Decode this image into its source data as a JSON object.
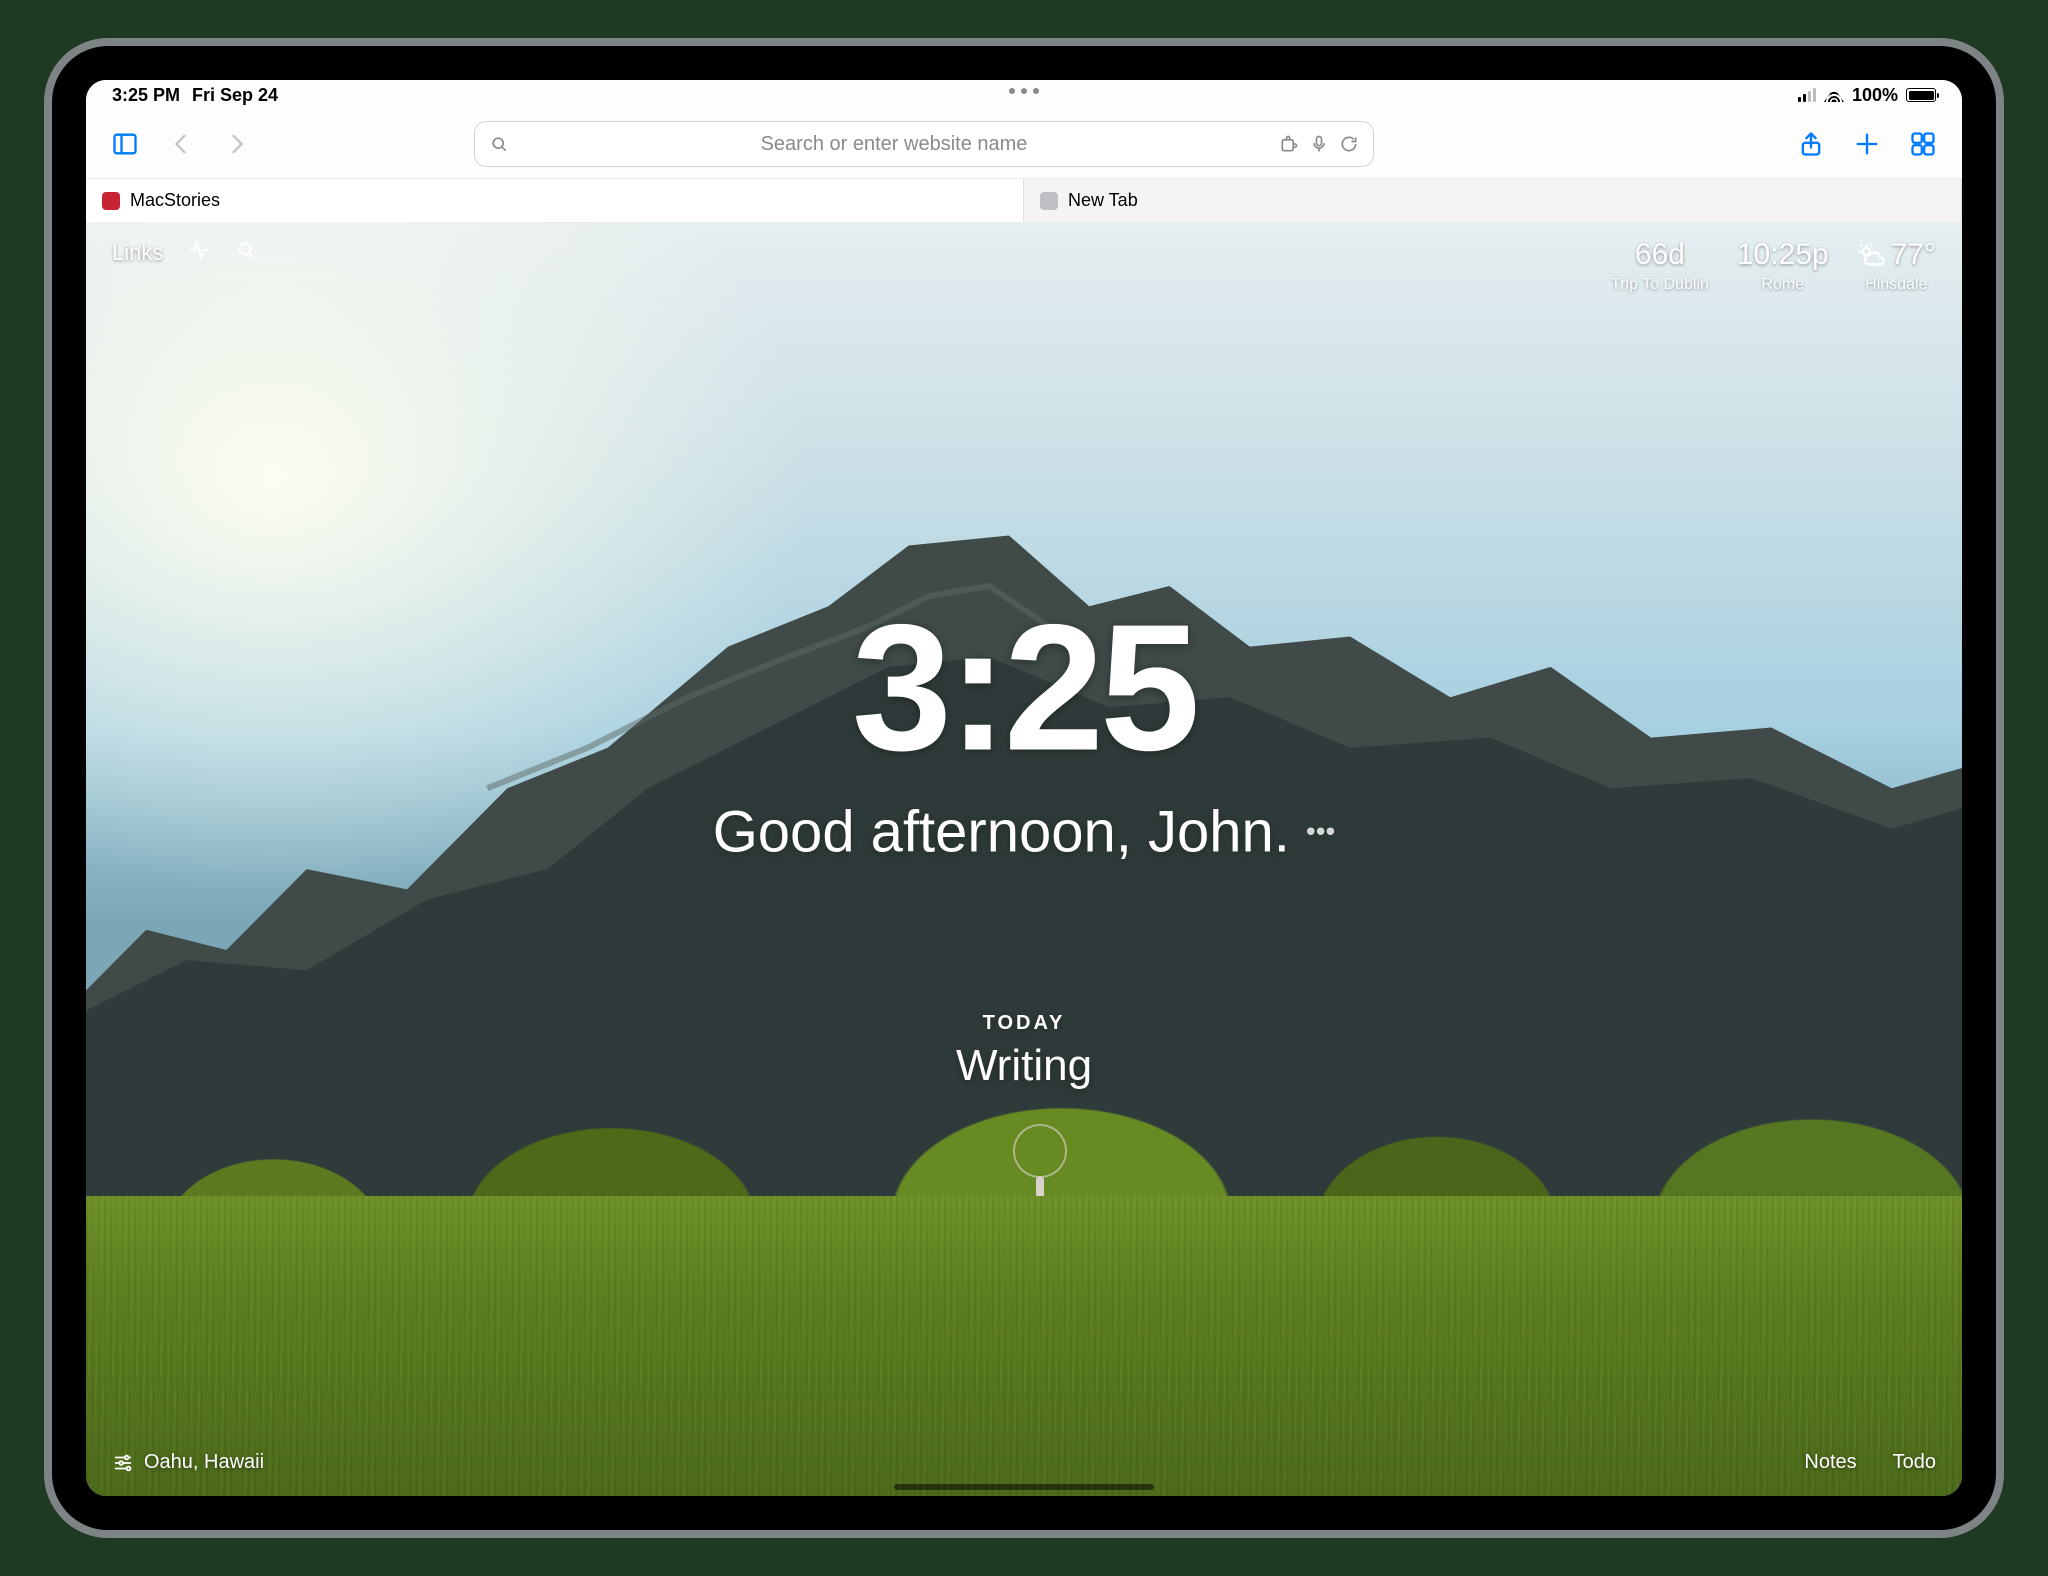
{
  "status_bar": {
    "time": "3:25 PM",
    "date": "Fri Sep 24",
    "battery_pct": "100%"
  },
  "safari": {
    "url_placeholder": "Search or enter website name",
    "tabs": [
      {
        "title": "MacStories",
        "active": true
      },
      {
        "title": "New Tab",
        "active": false
      }
    ]
  },
  "momentum": {
    "top_left": {
      "links_label": "Links"
    },
    "top_right": [
      {
        "big": "66d",
        "small": "Trip To Dublin",
        "kind": "countdown"
      },
      {
        "big": "10:25p",
        "small": "Rome",
        "kind": "clock"
      },
      {
        "big": "77°",
        "small": "Hinsdale",
        "kind": "weather"
      }
    ],
    "clock": "3:25",
    "greeting": "Good afternoon, John.",
    "focus_label": "TODAY",
    "focus_value": "Writing",
    "photo_location": "Oahu, Hawaii",
    "bottom_right": [
      {
        "label": "Notes"
      },
      {
        "label": "Todo"
      }
    ]
  }
}
